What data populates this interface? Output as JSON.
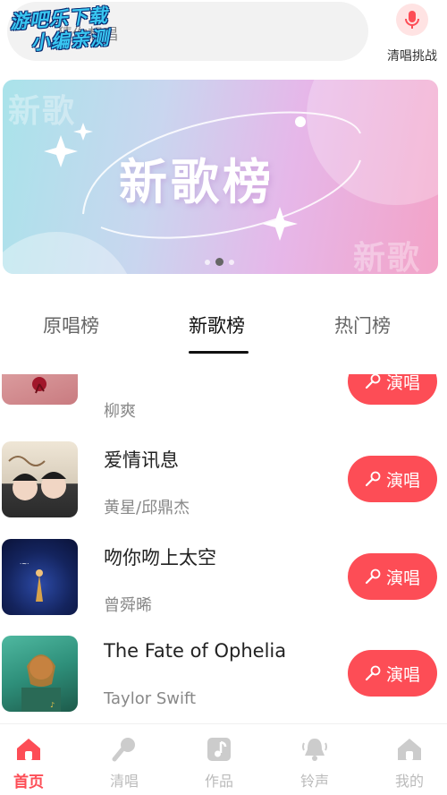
{
  "header": {
    "search_placeholder": "猜你想唱",
    "watermark_line1": "游吧乐下载",
    "watermark_line2": "小编亲测",
    "solo_label": "清唱挑战"
  },
  "banner": {
    "title": "新歌榜",
    "ghost_text_1": "新歌",
    "ghost_text_2": "新歌",
    "active_dot_index": 1,
    "dot_count": 2
  },
  "tabs": [
    {
      "label": "原唱榜",
      "active": false
    },
    {
      "label": "新歌榜",
      "active": true
    },
    {
      "label": "热门榜",
      "active": false
    }
  ],
  "songs": [
    {
      "title": "",
      "artist": "柳爽",
      "button": "演唱"
    },
    {
      "title": "爱情讯息",
      "artist": "黄星/邱鼎杰",
      "button": "演唱"
    },
    {
      "title": "吻你吻上太空",
      "artist": "曾舜晞",
      "button": "演唱"
    },
    {
      "title": "The Fate of Ophelia",
      "artist": "Taylor Swift",
      "button": "演唱"
    }
  ],
  "nav": [
    {
      "label": "首页",
      "icon": "home-icon",
      "active": true
    },
    {
      "label": "清唱",
      "icon": "microphone-icon",
      "active": false
    },
    {
      "label": "作品",
      "icon": "music-note-icon",
      "active": false
    },
    {
      "label": "铃声",
      "icon": "bell-icon",
      "active": false
    },
    {
      "label": "我的",
      "icon": "profile-home-icon",
      "active": false
    }
  ],
  "colors": {
    "accent": "#fd4d56",
    "nav_inactive": "#bbbbbb"
  }
}
